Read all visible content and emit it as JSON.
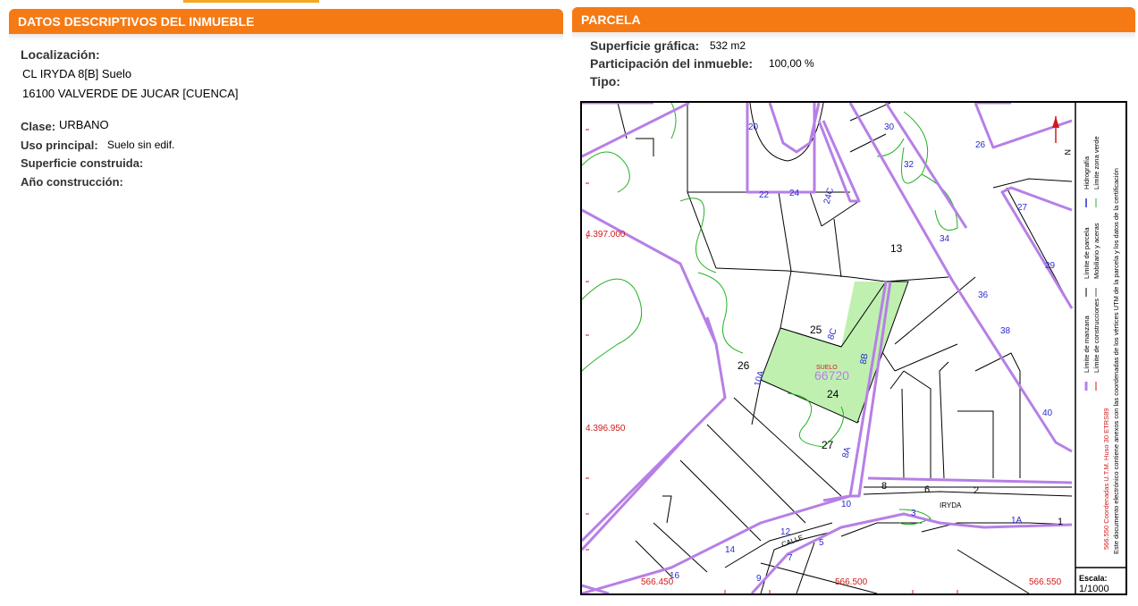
{
  "left_panel": {
    "header": "DATOS DESCRIPTIVOS DEL INMUEBLE",
    "localizacion_label": "Localización:",
    "address_line1": "CL IRYDA 8[B] Suelo",
    "address_line2": "16100 VALVERDE DE JUCAR [CUENCA]",
    "clase_label": "Clase:",
    "clase_value": "URBANO",
    "uso_label": "Uso principal:",
    "uso_value": "Suelo sin edif.",
    "superficie_label": "Superficie construida:",
    "anio_label": "Año construcción:"
  },
  "right_panel": {
    "header": "PARCELA",
    "superficie_label": "Superficie gráfica:",
    "superficie_value": "532 m2",
    "participacion_label": "Participación del inmueble:",
    "participacion_value": "100,00 %",
    "tipo_label": "Tipo:"
  },
  "map": {
    "coord_y1": "4.397.000",
    "coord_y2": "4.396.950",
    "coord_x1": "566.450",
    "coord_x2": "566.500",
    "coord_x3": "566.550",
    "parcel_id": "66720",
    "parcel_tag": "SUELO",
    "street_name": "IRYDA",
    "street_type": "CALLE",
    "numbers_black": [
      "13",
      "25",
      "26",
      "24",
      "27",
      "8",
      "6",
      "2",
      "1"
    ],
    "numbers_blue": [
      "20",
      "22",
      "24",
      "24C",
      "30",
      "32",
      "34",
      "36",
      "38",
      "40",
      "26",
      "27",
      "29",
      "8C",
      "8B",
      "10A",
      "8A",
      "10",
      "12",
      "14",
      "16",
      "9",
      "7",
      "5",
      "3",
      "1A"
    ],
    "legend": {
      "col1_a": "Límite de manzana",
      "col1_b": "Límite de parcela",
      "col1_c": "Hidrografía",
      "col2_a": "Límite de construcciones",
      "col2_b": "Mobiliario y aceras",
      "col2_c": "Límite zona verde",
      "coords_note": "566.550 Coordenadas U.T.M. Huso 30 ETRS89",
      "doc_note": "Este documento electrónico contiene anexos con las coordenadas de los vértices UTM de la parcela y los datos de la certificación"
    },
    "scale_label": "Escala:",
    "scale_value": "1/1000",
    "north_label": "N"
  },
  "colors": {
    "header_orange": "#f57a14",
    "block_purple": "#b77fe6",
    "label_blue": "#2b2bd0",
    "parcel_green": "#bff0b0",
    "zone_green": "#24b024",
    "coord_red": "#d21a1a"
  }
}
